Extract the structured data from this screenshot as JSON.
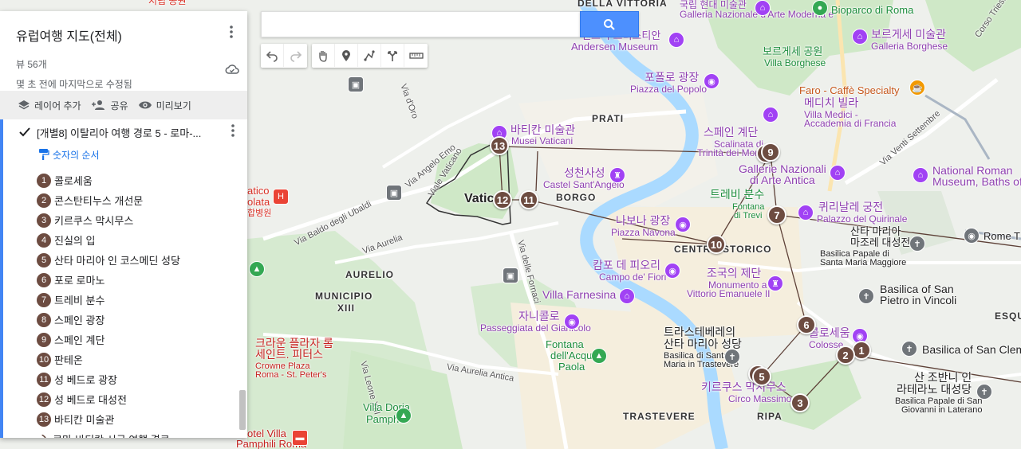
{
  "panel": {
    "title": "유럽여행 지도(전체)",
    "views": "뷰 56개",
    "saved_status": "몇 초 전에 마지막으로 수정됨",
    "actions": {
      "add_layer": "레이어 추가",
      "share": "공유",
      "preview": "미리보기"
    },
    "layer": {
      "name": "[개별8] 이탈리아 여행 경로 5 - 로마-...",
      "style": "숫자의 순서",
      "places": [
        {
          "n": "1",
          "name": "콜로세움"
        },
        {
          "n": "2",
          "name": "콘스탄티누스 개선문"
        },
        {
          "n": "3",
          "name": "키르쿠스 막시무스"
        },
        {
          "n": "4",
          "name": "진실의 입"
        },
        {
          "n": "5",
          "name": "산타 마리아 인 코스메딘 성당"
        },
        {
          "n": "6",
          "name": "포로 로마노"
        },
        {
          "n": "7",
          "name": "트레비 분수"
        },
        {
          "n": "8",
          "name": "스페인 광장"
        },
        {
          "n": "9",
          "name": "스페인 계단"
        },
        {
          "n": "10",
          "name": "판테온"
        },
        {
          "n": "11",
          "name": "성 베드로 광장"
        },
        {
          "n": "12",
          "name": "성 베드로 대성전"
        },
        {
          "n": "13",
          "name": "바티칸 미술관"
        }
      ],
      "route": "로마-바티칸 시국 여행 경로"
    }
  },
  "search": {
    "placeholder": ""
  },
  "map": {
    "labels": {
      "della_vittoria": "DELLA VITTORIA",
      "prati": "PRATI",
      "borgo": "BORGO",
      "vatican": "Vatic",
      "aurelio": "AURELIO",
      "municipio": "MUNICIPIO",
      "xiii": "XIII",
      "centro_storico": "CENTRO STORICO",
      "trastevere": "TRASTEVERE",
      "ripa": "RIPA",
      "esqu": "ESQU",
      "via_angelo_emo": "Via Angelo Emo",
      "viale_vaticano": "Viale Vaticano",
      "via_baldo": "Via Baldo degli Ubaldi",
      "via_aurelia": "Via Aurelia",
      "via_fornaci": "Via delle Fornaci",
      "via_aurelia_antica": "Via Aurelia Antica",
      "via_leone": "Via Leone XIII",
      "via_venti": "Via Venti Settembre",
      "viale_trieste": "Corso Trieste",
      "via_oro": "Via d'Oro",
      "andersen_ko": "헨드릭 크리스티안",
      "andersen_en": "Andersen Museum",
      "gnam_ko": "국립 현대 미술관",
      "gnam_en": "Galleria Nazionale d'Arte Moderna e",
      "bioparco": "Bioparco di Roma",
      "borghese_gallery_ko": "보르게세 미술관",
      "borghese_gallery_en": "Galleria Borghese",
      "villa_borghese_ko": "보르게세 공원",
      "villa_borghese_en": "Villa Borghese",
      "popolo_ko": "포폴로 광장",
      "popolo_en": "Piazza del Popolo",
      "faro": "Faro - Caffè Specialty",
      "medici_ko": "메디치 빌라",
      "medici_en": "Villa Medici -",
      "medici_en2": "Accademia di Francia",
      "vaticani_ko": "바티칸 미술관",
      "vaticani_en": "Musei Vaticani",
      "angelo_ko": "성천사성",
      "angelo_en": "Castel Sant'Angelo",
      "spanish_steps_ko": "스페인 계단",
      "spanish_steps_en": "Scalinata di",
      "spanish_steps_en2": "Trinità dei Monti",
      "gallerie_ko": "Gallerie Nazionali",
      "gallerie_en": "di Arte Antica",
      "national_roman": "National Roman",
      "museum_baths": "Museum, Baths of",
      "trevi_ko": "트레비 분수",
      "trevi_en": "Fontana",
      "trevi_en2": "di Trevi",
      "quirinale_ko": "퀴리날레 궁전",
      "quirinale_en": "Palazzo del Quirinale",
      "santa_maria_ko": "산타 마리아",
      "santa_maria_ko2": "마조레 대성전",
      "santa_maria_en": "Basilica Papale di",
      "santa_maria_en2": "Santa Maria Maggiore",
      "rome_t": "Rome T",
      "navona_ko": "나보나 광장",
      "navona_en": "Piazza Navona",
      "campo_ko": "캄포 데 피오리",
      "campo_en": "Campo de' Fiori",
      "vittoriano_ko": "조국의 제단",
      "vittoriano_en": "Monumento a",
      "vittoriano_en2": "Vittorio Emanuele II",
      "farnesina": "Villa Farnesina",
      "gianicolo_ko": "자니콜로",
      "gianicolo_en": "Passeggiata del Gianicolo",
      "san_pietro_vincoli": "Basilica of San",
      "san_pietro_vincoli2": "Pietro in Vincoli",
      "colosseum_ko": "콜로세움",
      "colosseum_en": "Colosse",
      "basilica_clemente": "Basilica of San Clem",
      "fontana_acqua": "Fontana",
      "fontana_acqua2": "dell'Acqua",
      "fontana_acqua3": "Paola",
      "trastevere_basilica_ko": "트라스테베레의",
      "trastevere_basilica_ko2": "산타 마리아 성당",
      "trastevere_basilica_en": "Basilica di Santa",
      "trastevere_basilica_en2": "Maria in Trastevere",
      "circo_ko": "키르쿠스 막시무스",
      "circo_en": "Circo Massimo",
      "lateran_ko": "산 조반니 인",
      "lateran_ko2": "라테라노 대성당",
      "lateran_en": "Basilica Papale di San",
      "lateran_en2": "Giovanni in Laterano",
      "crown_ko": "크라운 플라자 롬",
      "crown_ko2": "세인트. 피터스",
      "crown_en": "Crowne Plaza",
      "crown_en2": "Roma - St. Peter's",
      "doria": "Villa Doria",
      "doria2": "Pamphili",
      "pamphili_hotel": "otel Villa",
      "pamphili_hotel2": "Pamphili Roma",
      "hospital1": "atico",
      "hospital2": "olata",
      "hospital3": "합병원",
      "top_label": "지립 공원"
    }
  },
  "colors": {
    "marker": "#6d4c41",
    "route": "#5d4037",
    "accent": "#4285f4"
  }
}
